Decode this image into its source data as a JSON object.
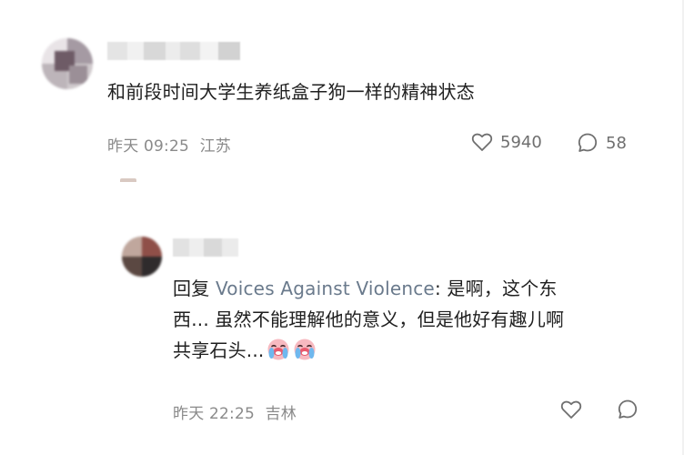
{
  "comments": [
    {
      "text": "和前段时间大学生养纸盒子狗一样的精神状态",
      "time": "昨天 09:25",
      "location": "江苏",
      "likes": "5940",
      "replies": "58"
    }
  ],
  "reply": {
    "prefix": "回复 ",
    "mention": "Voices Against Violence",
    "line1_rest": ": 是啊，这个东",
    "line2": "西... 虽然不能理解他的意义，但是他好有趣儿啊",
    "line3": "共享石头...",
    "time": "昨天 22:25",
    "location": "吉林"
  },
  "icons": {
    "like": "heart-outline-icon",
    "comment": "speech-bubble-icon",
    "emoji": "crying-face-emoji"
  }
}
